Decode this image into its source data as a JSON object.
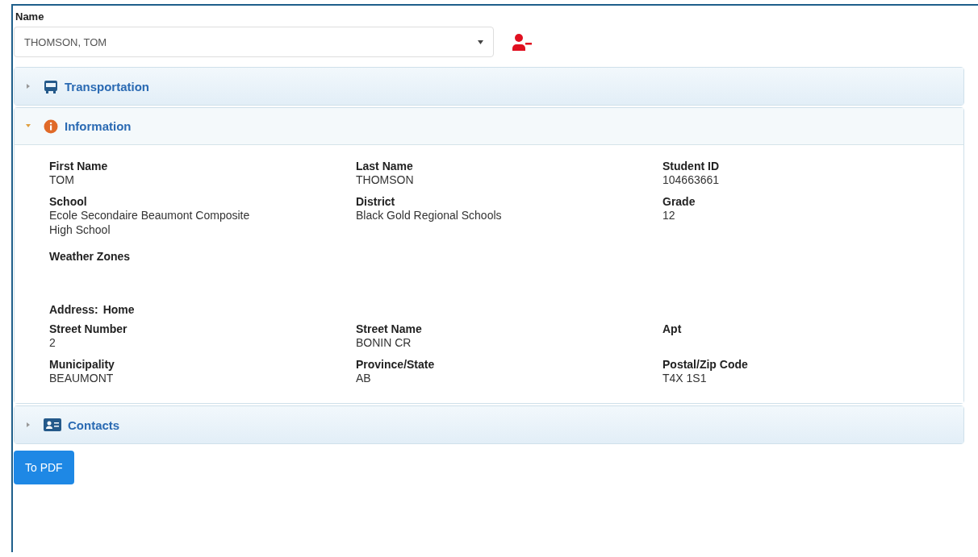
{
  "name_field": {
    "label": "Name",
    "value": "THOMSON, TOM"
  },
  "sections": [
    {
      "kind": "transportation",
      "title": "Transportation",
      "expanded": false
    },
    {
      "kind": "information",
      "title": "Information",
      "expanded": true,
      "fields": [
        {
          "label": "First Name",
          "value": "TOM"
        },
        {
          "label": "Last Name",
          "value": "THOMSON"
        },
        {
          "label": "Student ID",
          "value": "104663661"
        },
        {
          "label": "School",
          "value": "Ecole Secondaire Beaumont Composite High School"
        },
        {
          "label": "District",
          "value": "Black Gold Regional Schools"
        },
        {
          "label": "Grade",
          "value": "12"
        }
      ],
      "weather_zones_label": "Weather Zones",
      "address_label": "Address:",
      "address_type": "Home",
      "address_fields": [
        {
          "label": "Street Number",
          "value": "2"
        },
        {
          "label": "Street Name",
          "value": "BONIN CR"
        },
        {
          "label": "Apt"
        },
        {
          "label": "Municipality",
          "value": "BEAUMONT"
        },
        {
          "label": "Province/State",
          "value": "AB"
        },
        {
          "label": "Postal/Zip Code",
          "value": "T4X 1S1"
        }
      ]
    },
    {
      "kind": "contacts",
      "title": "Contacts",
      "expanded": false
    }
  ],
  "pdf_button": "To PDF"
}
